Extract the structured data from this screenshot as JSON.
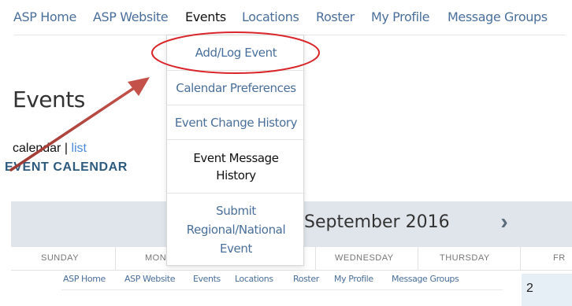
{
  "nav": {
    "items": [
      {
        "label": "ASP Home",
        "active": false
      },
      {
        "label": "ASP Website",
        "active": false
      },
      {
        "label": "Events",
        "active": true
      },
      {
        "label": "Locations",
        "active": false
      },
      {
        "label": "Roster",
        "active": false
      },
      {
        "label": "My Profile",
        "active": false
      },
      {
        "label": "Message Groups",
        "active": false
      }
    ]
  },
  "dropdown": {
    "items": [
      {
        "label": "Add/Log Event"
      },
      {
        "label": "Calendar Preferences"
      },
      {
        "label": "Event Change History"
      },
      {
        "label": "Event Message History"
      },
      {
        "label": "Submit Regional/National Event"
      }
    ],
    "highlight_color": "#d9262a"
  },
  "page": {
    "title": "Events",
    "view_calendar": "calendar",
    "view_sep": "|",
    "view_list": "list",
    "calendar_heading": "EVENT CALENDAR"
  },
  "calendar": {
    "month": "September 2016",
    "next_icon": "chevron-right-icon",
    "weekdays": [
      "SUNDAY",
      "MON",
      "WEDNESDAY",
      "THURSDAY",
      "FR"
    ],
    "first_visible_day": "2"
  },
  "thumbnail_nav": {
    "items": [
      "ASP Home",
      "ASP Website",
      "Events",
      "Locations",
      "Roster",
      "My Profile",
      "Message Groups"
    ]
  },
  "colors": {
    "nav_link": "#4a6f9a",
    "heading_blue": "#2e5a7d",
    "list_link": "#4a8ad9",
    "annotation_red": "#b8463f"
  }
}
